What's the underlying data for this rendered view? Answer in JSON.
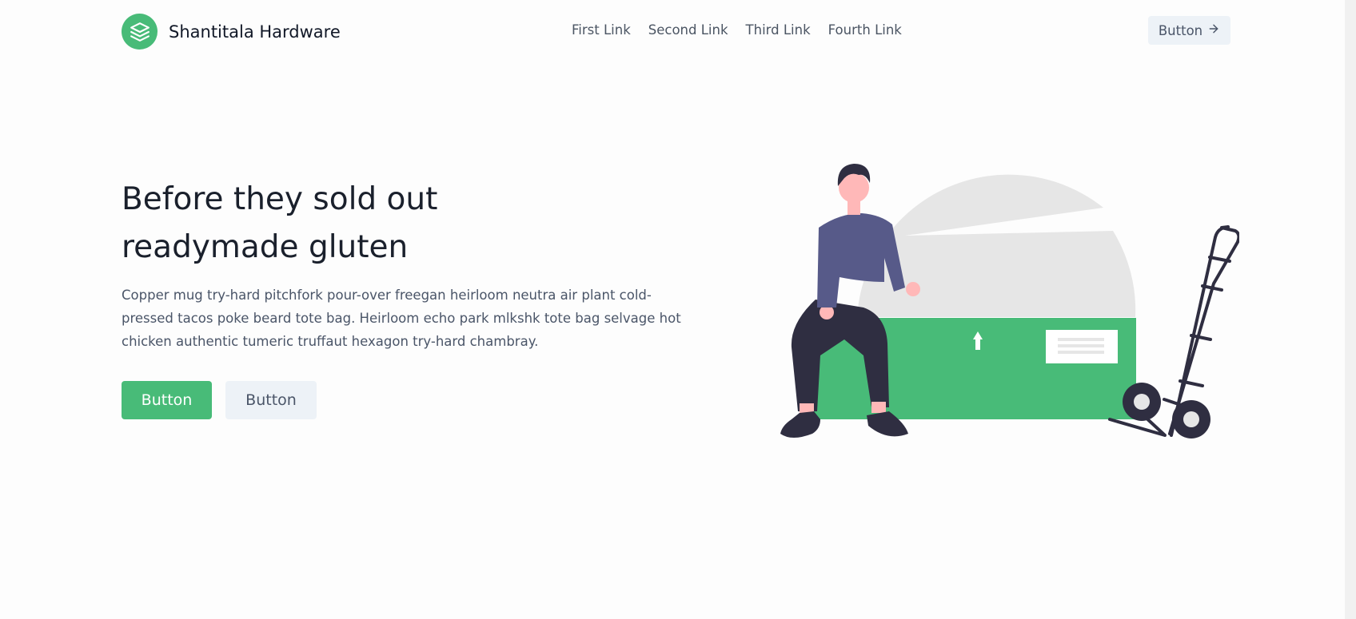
{
  "header": {
    "brand_name": "Shantitala Hardware",
    "nav": [
      "First Link",
      "Second Link",
      "Third Link",
      "Fourth Link"
    ],
    "button_label": "Button",
    "button_icon": "arrow-right-icon"
  },
  "hero": {
    "title_line1": "Before they sold out",
    "title_line2": "readymade gluten",
    "description": "Copper mug try-hard pitchfork pour-over freegan heirloom neutra air plant cold-pressed tacos poke beard tote bag. Heirloom echo park mlkshk tote bag selvage hot chicken authentic tumeric truffaut hexagon try-hard chambray.",
    "primary_button": "Button",
    "secondary_button": "Button"
  },
  "colors": {
    "accent": "#48bb78",
    "button_secondary_bg": "#edf2f7",
    "illustration_dark": "#2f2e41",
    "illustration_shirt": "#575a89",
    "illustration_skin": "#ffb8b8"
  },
  "icons": {
    "logo": "layers-icon",
    "arrow": "arrow-right-icon"
  }
}
